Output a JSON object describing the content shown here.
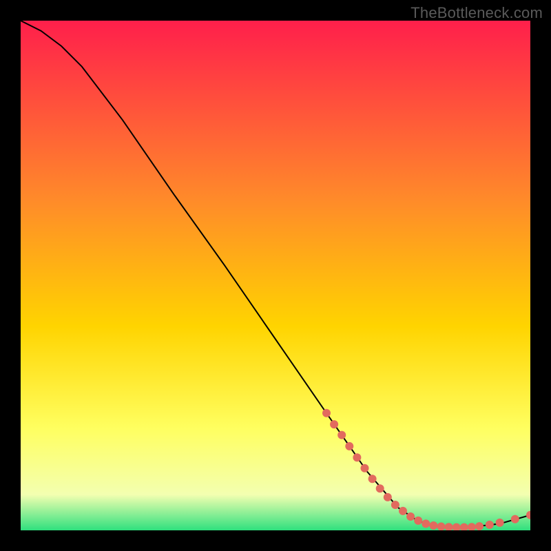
{
  "watermark": "TheBottleneck.com",
  "gradient": {
    "top": "#ff1f4b",
    "mid1": "#ff8a2a",
    "mid2": "#ffd400",
    "mid3": "#ffff60",
    "mid4": "#f3ffb0",
    "bottom": "#2fe07e"
  },
  "chart_data": {
    "type": "line",
    "title": "",
    "xlabel": "",
    "ylabel": "",
    "xlim": [
      0,
      100
    ],
    "ylim": [
      0,
      100
    ],
    "grid": false,
    "legend": false,
    "curve": [
      {
        "x": 0,
        "y": 100
      },
      {
        "x": 4,
        "y": 98
      },
      {
        "x": 8,
        "y": 95
      },
      {
        "x": 12,
        "y": 91
      },
      {
        "x": 20,
        "y": 80.5
      },
      {
        "x": 30,
        "y": 66
      },
      {
        "x": 40,
        "y": 52
      },
      {
        "x": 50,
        "y": 37.5
      },
      {
        "x": 60,
        "y": 23
      },
      {
        "x": 68,
        "y": 11.5
      },
      {
        "x": 74,
        "y": 4.5
      },
      {
        "x": 78,
        "y": 1.8
      },
      {
        "x": 82,
        "y": 0.8
      },
      {
        "x": 88,
        "y": 0.6
      },
      {
        "x": 94,
        "y": 1.3
      },
      {
        "x": 100,
        "y": 3.0
      }
    ],
    "markers": [
      {
        "x": 60.0,
        "y": 23.0
      },
      {
        "x": 61.5,
        "y": 20.8
      },
      {
        "x": 63.0,
        "y": 18.7
      },
      {
        "x": 64.5,
        "y": 16.5
      },
      {
        "x": 66.0,
        "y": 14.3
      },
      {
        "x": 67.5,
        "y": 12.2
      },
      {
        "x": 69.0,
        "y": 10.1
      },
      {
        "x": 70.5,
        "y": 8.2
      },
      {
        "x": 72.0,
        "y": 6.5
      },
      {
        "x": 73.5,
        "y": 5.0
      },
      {
        "x": 75.0,
        "y": 3.8
      },
      {
        "x": 76.5,
        "y": 2.7
      },
      {
        "x": 78.0,
        "y": 1.9
      },
      {
        "x": 79.5,
        "y": 1.3
      },
      {
        "x": 81.0,
        "y": 0.95
      },
      {
        "x": 82.5,
        "y": 0.75
      },
      {
        "x": 84.0,
        "y": 0.65
      },
      {
        "x": 85.5,
        "y": 0.6
      },
      {
        "x": 87.0,
        "y": 0.6
      },
      {
        "x": 88.5,
        "y": 0.65
      },
      {
        "x": 90.0,
        "y": 0.8
      },
      {
        "x": 92.0,
        "y": 1.1
      },
      {
        "x": 94.0,
        "y": 1.5
      },
      {
        "x": 97.0,
        "y": 2.2
      },
      {
        "x": 100.0,
        "y": 3.0
      }
    ],
    "marker_color": "#e26a5e",
    "line_color": "#000000"
  }
}
